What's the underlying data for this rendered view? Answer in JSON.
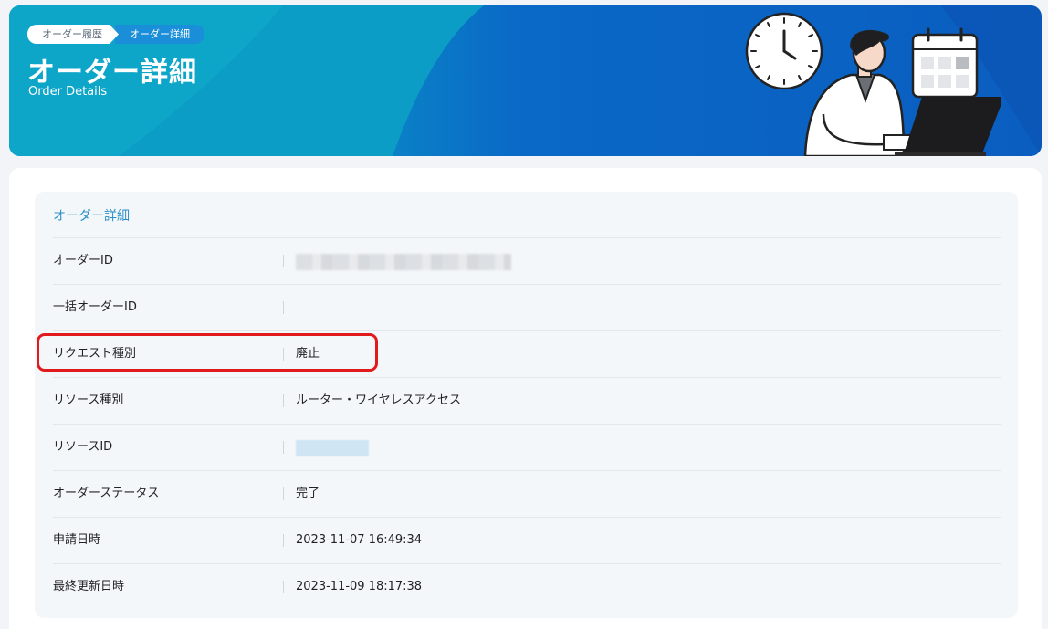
{
  "header": {
    "breadcrumb": [
      "オーダー履歴",
      "オーダー詳細"
    ],
    "title": "オーダー詳細",
    "subtitle": "Order Details"
  },
  "panel": {
    "title": "オーダー詳細",
    "rows": [
      {
        "label": "オーダーID",
        "value": ""
      },
      {
        "label": "一括オーダーID",
        "value": ""
      },
      {
        "label": "リクエスト種別",
        "value": "廃止"
      },
      {
        "label": "リソース種別",
        "value": "ルーター・ワイヤレスアクセス"
      },
      {
        "label": "リソースID",
        "value": ""
      },
      {
        "label": "オーダーステータス",
        "value": "完了"
      },
      {
        "label": "申請日時",
        "value": "2023-11-07 16:49:34"
      },
      {
        "label": "最終更新日時",
        "value": "2023-11-09 18:17:38"
      }
    ]
  },
  "colors": {
    "accent": "#2a8fc7",
    "highlight": "#e11b1b"
  },
  "icons": [
    "clock-icon",
    "calendar-icon",
    "person-at-laptop-illustration"
  ]
}
